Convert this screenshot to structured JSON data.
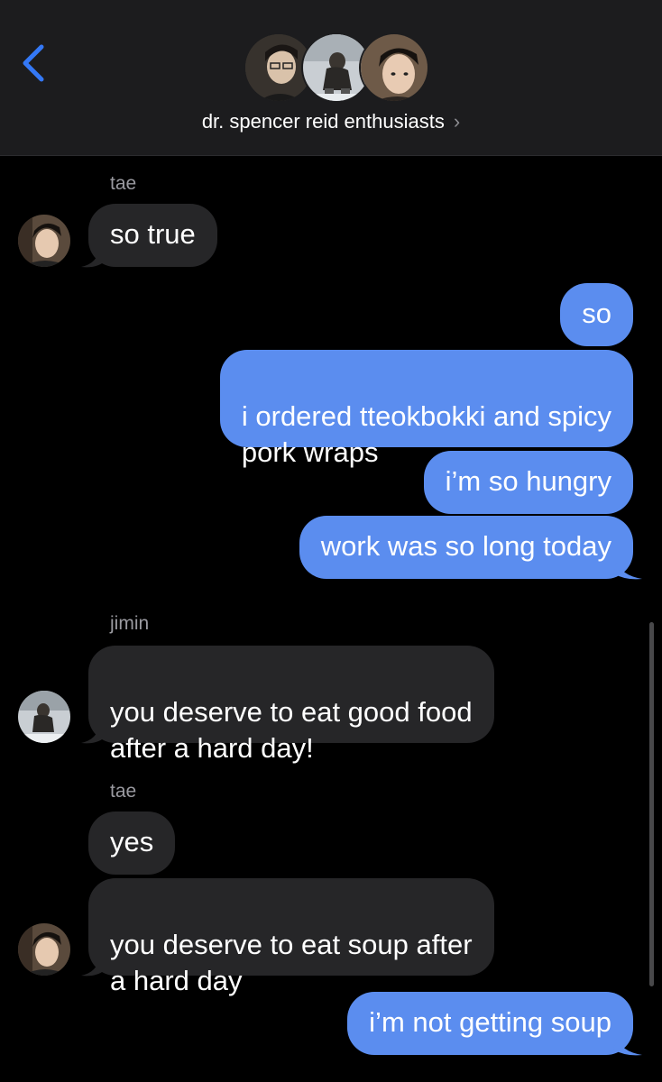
{
  "header": {
    "title": "dr. spencer reid enthusiasts",
    "chevron": "›",
    "back_icon": "chevron-left-icon"
  },
  "colors": {
    "background": "#000000",
    "incoming_bubble": "#262628",
    "outgoing_bubble": "#5b8def",
    "accent": "#3478f6"
  },
  "messages": [
    {
      "sender": "tae",
      "text": "so true"
    },
    {
      "sender": "me",
      "text": "so"
    },
    {
      "sender": "me",
      "text": "i ordered tteokbokki and spicy\npork wraps"
    },
    {
      "sender": "me",
      "text": "i’m so hungry"
    },
    {
      "sender": "me",
      "text": "work was so long today"
    },
    {
      "sender": "jimin",
      "text": "you deserve to eat good food\nafter a hard day!"
    },
    {
      "sender": "tae",
      "text": "yes"
    },
    {
      "sender": "tae",
      "text": "you deserve to eat soup after\na hard day"
    },
    {
      "sender": "me",
      "text": "i’m not getting soup"
    }
  ],
  "labels": {
    "tae_1": "tae",
    "jimin": "jimin",
    "tae_2": "tae"
  }
}
